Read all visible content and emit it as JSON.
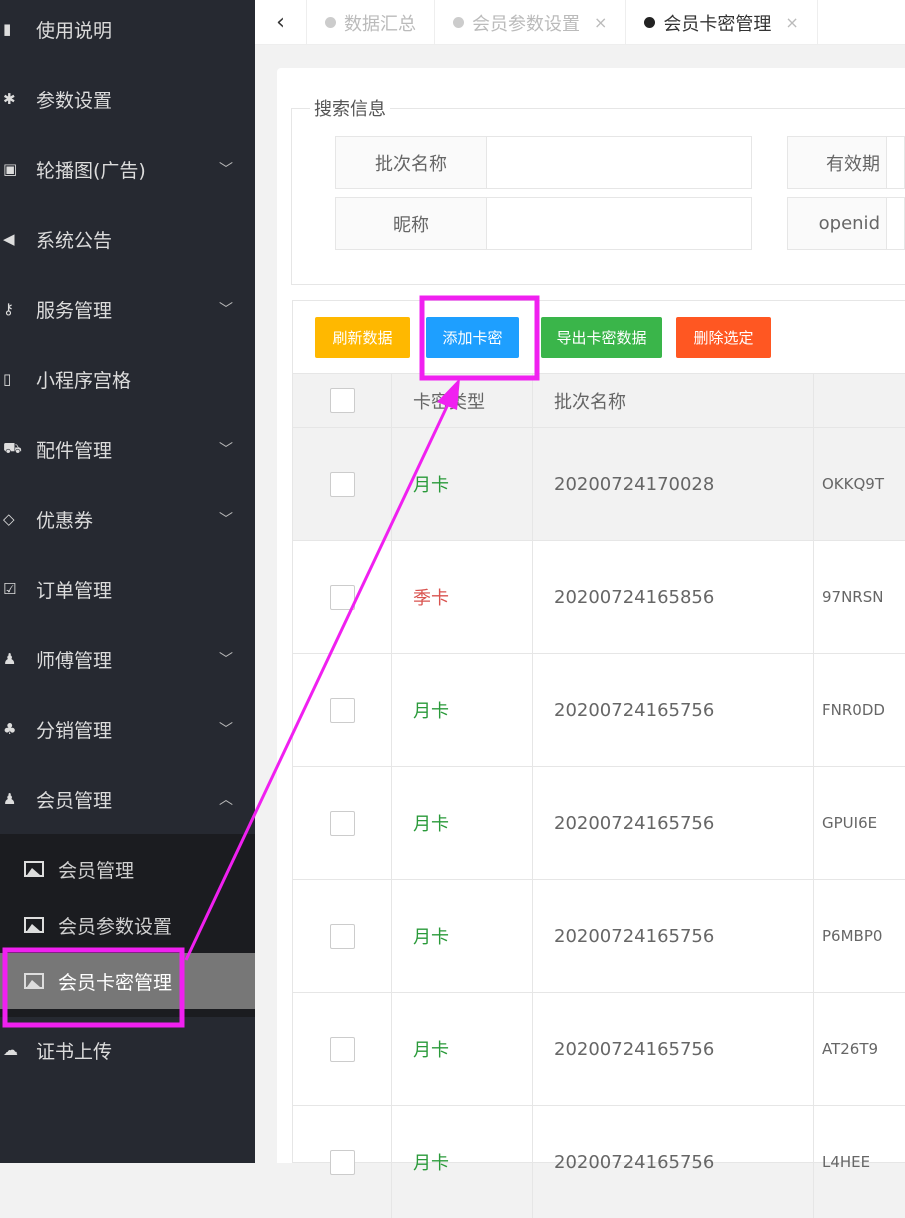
{
  "sidebar": {
    "items": [
      {
        "label": "使用说明",
        "icon": "book-icon",
        "glyph": "▮",
        "chev": ""
      },
      {
        "label": "参数设置",
        "icon": "gear-icon",
        "glyph": "✱",
        "chev": ""
      },
      {
        "label": "轮播图(广告)",
        "icon": "image-icon",
        "glyph": "▣",
        "chev": "﹀"
      },
      {
        "label": "系统公告",
        "icon": "volume-icon",
        "glyph": "◀",
        "chev": ""
      },
      {
        "label": "服务管理",
        "icon": "key-icon",
        "glyph": "⚷",
        "chev": "﹀"
      },
      {
        "label": "小程序宫格",
        "icon": "mobile-icon",
        "glyph": "▯",
        "chev": ""
      },
      {
        "label": "配件管理",
        "icon": "cart-icon",
        "glyph": "⛟",
        "chev": "﹀"
      },
      {
        "label": "优惠券",
        "icon": "diamond-icon",
        "glyph": "◇",
        "chev": "﹀"
      },
      {
        "label": "订单管理",
        "icon": "check-square-icon",
        "glyph": "☑",
        "chev": ""
      },
      {
        "label": "师傅管理",
        "icon": "user-tie-icon",
        "glyph": "♟",
        "chev": "﹀"
      },
      {
        "label": "分销管理",
        "icon": "user-plus-icon",
        "glyph": "♣",
        "chev": "﹀"
      },
      {
        "label": "会员管理",
        "icon": "user-icon",
        "glyph": "♟",
        "chev": "︿"
      }
    ],
    "sub_items": [
      {
        "label": "会员管理"
      },
      {
        "label": "会员参数设置"
      },
      {
        "label": "会员卡密管理",
        "active": true
      }
    ],
    "last_item": {
      "label": "证书上传",
      "glyph": "☁"
    }
  },
  "tabs": [
    {
      "label": "数据汇总",
      "closable": false
    },
    {
      "label": "会员参数设置",
      "closable": true
    },
    {
      "label": "会员卡密管理",
      "closable": true,
      "active": true
    }
  ],
  "tab_close": "×",
  "back": "‹",
  "search": {
    "legend": "搜索信息",
    "fields": [
      {
        "label": "批次名称",
        "value": ""
      },
      {
        "label": "有效期",
        "value": ""
      },
      {
        "label": "昵称",
        "value": ""
      },
      {
        "label": "openid",
        "value": ""
      }
    ]
  },
  "toolbar": {
    "refresh": "刷新数据",
    "add": "添加卡密",
    "export": "导出卡密数据",
    "delete": "删除选定"
  },
  "colors": {
    "refresh": "#ffb800",
    "add": "#1e9fff",
    "export": "#3ab54a",
    "delete": "#ff5722",
    "month": "#2a9a3a",
    "season": "#d9534f",
    "annotation": "#f020f0"
  },
  "table": {
    "headers": [
      "卡密类型",
      "批次名称",
      ""
    ],
    "rows": [
      {
        "type": "月卡",
        "batch": "20200724170028",
        "code": "OKKQ9T"
      },
      {
        "type": "季卡",
        "batch": "20200724165856",
        "code": "97NRSN"
      },
      {
        "type": "月卡",
        "batch": "20200724165756",
        "code": "FNR0DD"
      },
      {
        "type": "月卡",
        "batch": "20200724165756",
        "code": "GPUI6E"
      },
      {
        "type": "月卡",
        "batch": "20200724165756",
        "code": "P6MBP0"
      },
      {
        "type": "月卡",
        "batch": "20200724165756",
        "code": "AT26T9"
      },
      {
        "type": "月卡",
        "batch": "20200724165756",
        "code": "L4HEE"
      }
    ]
  }
}
